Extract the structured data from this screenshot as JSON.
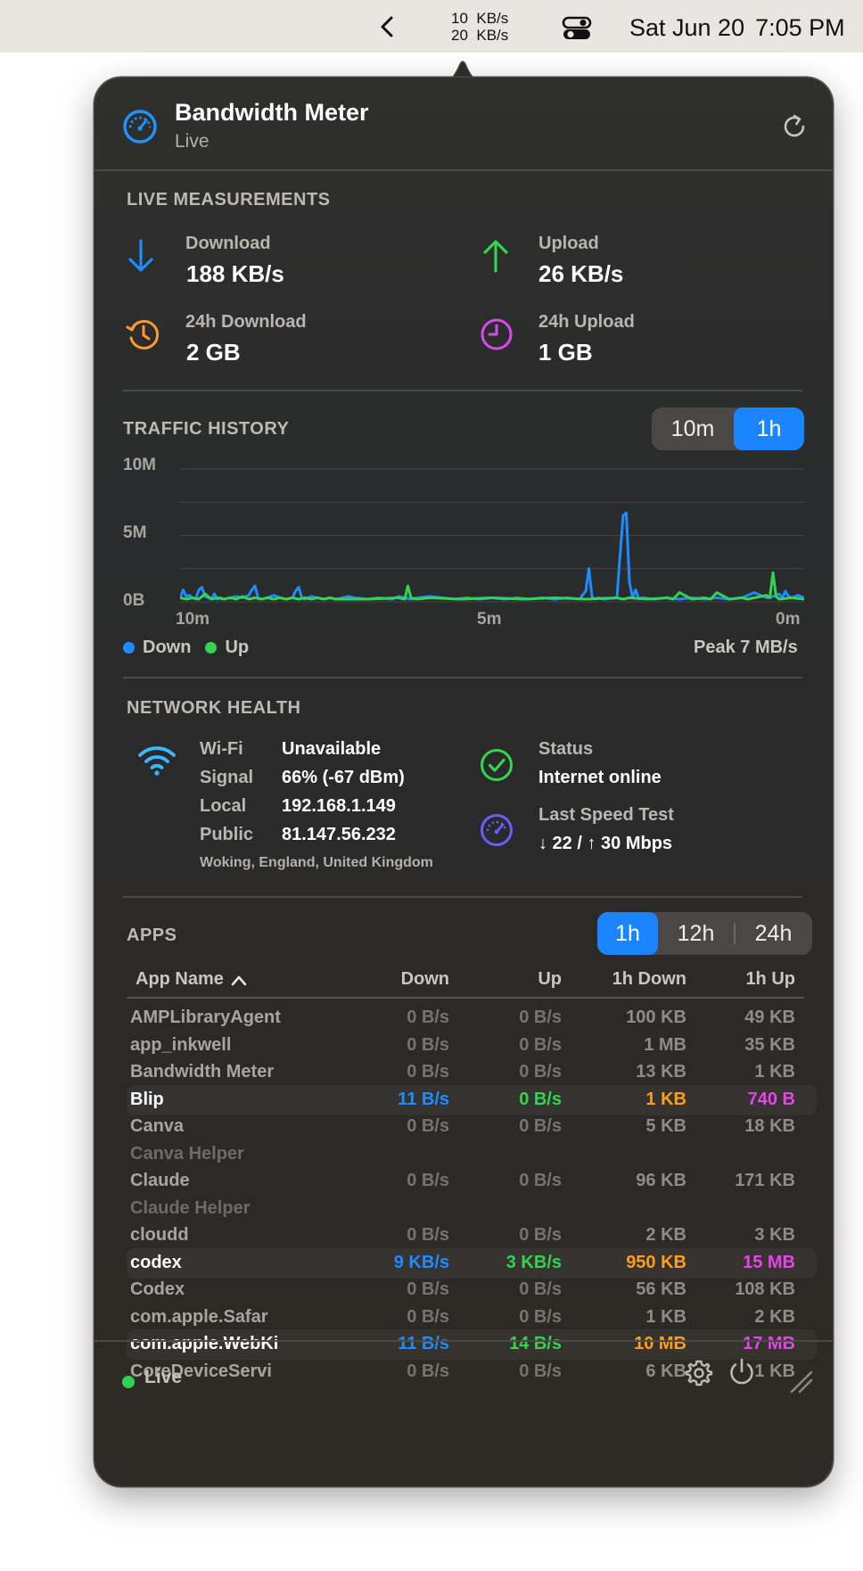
{
  "menubar": {
    "rate_down": "10  KB/s",
    "rate_up": "20  KB/s",
    "date": "Sat Jun 20",
    "time": "7:05 PM"
  },
  "header": {
    "title": "Bandwidth Meter",
    "subtitle": "Live",
    "icon": "gauge-icon",
    "refresh_icon": "refresh-icon"
  },
  "live": {
    "title": "LIVE MEASUREMENTS",
    "download_label": "Download",
    "download_value": "188 KB/s",
    "upload_label": "Upload",
    "upload_value": "26 KB/s",
    "day_download_label": "24h Download",
    "day_download_value": "2 GB",
    "day_upload_label": "24h Upload",
    "day_upload_value": "1 GB"
  },
  "traffic": {
    "title": "TRAFFIC HISTORY",
    "ranges": [
      "10m",
      "1h"
    ],
    "selected_range": "1h",
    "legend_down": "Down",
    "legend_up": "Up",
    "peak": "Peak 7 MB/s"
  },
  "chart_data": {
    "type": "line",
    "y_ticks": [
      "10M",
      "5M",
      "0B"
    ],
    "x_ticks": [
      "10m",
      "5m",
      "0m"
    ],
    "ylim": [
      0,
      10
    ],
    "xlim": [
      10,
      0
    ],
    "grid": true,
    "legend_placement": "bottom-left",
    "series": [
      {
        "name": "Down",
        "color": "#1e8cff",
        "x": [
          10.0,
          9.95,
          9.9,
          9.85,
          9.8,
          9.75,
          9.7,
          9.65,
          9.6,
          9.55,
          9.5,
          9.45,
          9.4,
          9.35,
          9.3,
          9.2,
          9.1,
          9.0,
          8.9,
          8.85,
          8.8,
          8.75,
          8.7,
          8.6,
          8.5,
          8.4,
          8.3,
          8.2,
          8.15,
          8.1,
          8.05,
          8.0,
          7.9,
          7.8,
          7.7,
          7.6,
          7.5,
          7.4,
          7.3,
          7.2,
          7.0,
          6.8,
          6.6,
          6.5,
          6.4,
          6.3,
          6.2,
          6.0,
          5.8,
          5.6,
          5.4,
          5.2,
          5.0,
          4.8,
          4.6,
          4.4,
          4.2,
          4.0,
          3.8,
          3.6,
          3.5,
          3.45,
          3.4,
          3.35,
          3.3,
          3.2,
          3.0,
          2.95,
          2.9,
          2.85,
          2.8,
          2.75,
          2.7,
          2.65,
          2.6,
          2.4,
          2.2,
          2.0,
          1.8,
          1.6,
          1.4,
          1.2,
          1.0,
          0.9,
          0.8,
          0.7,
          0.6,
          0.5,
          0.4,
          0.35,
          0.3,
          0.25,
          0.2,
          0.1,
          0.0
        ],
        "values": [
          0.3,
          0.9,
          0.4,
          0.5,
          0.3,
          0.2,
          0.9,
          1.1,
          0.4,
          0.3,
          0.2,
          0.6,
          0.2,
          0.3,
          0.2,
          0.3,
          0.4,
          0.3,
          0.5,
          0.9,
          1.2,
          0.3,
          0.2,
          0.3,
          0.5,
          0.3,
          0.2,
          0.3,
          0.8,
          1.1,
          0.3,
          0.2,
          0.4,
          0.3,
          0.2,
          0.3,
          0.2,
          0.3,
          0.4,
          0.3,
          0.2,
          0.3,
          0.2,
          0.4,
          0.3,
          0.2,
          0.3,
          0.4,
          0.3,
          0.2,
          0.3,
          0.2,
          0.3,
          0.2,
          0.3,
          0.2,
          0.3,
          0.2,
          0.3,
          0.2,
          0.8,
          2.5,
          0.4,
          0.2,
          0.3,
          0.2,
          0.3,
          3.5,
          6.5,
          6.7,
          1.5,
          0.3,
          0.9,
          0.2,
          0.3,
          0.2,
          0.3,
          0.2,
          0.3,
          0.2,
          0.3,
          0.2,
          0.3,
          0.5,
          0.7,
          0.5,
          0.3,
          0.4,
          0.6,
          0.3,
          0.8,
          0.4,
          0.3,
          0.5,
          0.3
        ]
      },
      {
        "name": "Up",
        "color": "#33d44f",
        "x": [
          10.0,
          9.9,
          9.8,
          9.7,
          9.6,
          9.5,
          9.4,
          9.3,
          9.2,
          9.1,
          9.0,
          8.9,
          8.8,
          8.7,
          8.6,
          8.5,
          8.4,
          8.3,
          8.2,
          8.1,
          8.0,
          7.9,
          7.8,
          7.7,
          7.6,
          7.5,
          7.0,
          6.5,
          6.4,
          6.35,
          6.3,
          6.2,
          6.0,
          5.5,
          5.0,
          4.5,
          4.0,
          3.5,
          3.0,
          2.9,
          2.8,
          2.5,
          2.2,
          2.1,
          2.0,
          1.8,
          1.6,
          1.5,
          1.4,
          1.2,
          1.0,
          0.9,
          0.6,
          0.55,
          0.5,
          0.45,
          0.4,
          0.2,
          0.0
        ],
        "values": [
          0.3,
          0.2,
          0.3,
          0.2,
          0.6,
          0.2,
          0.3,
          0.2,
          0.3,
          0.2,
          0.4,
          0.2,
          0.3,
          0.2,
          0.3,
          0.2,
          0.3,
          0.2,
          0.3,
          0.2,
          0.3,
          0.2,
          0.3,
          0.2,
          0.3,
          0.2,
          0.2,
          0.3,
          0.2,
          1.2,
          0.3,
          0.2,
          0.3,
          0.2,
          0.3,
          0.2,
          0.3,
          0.2,
          0.3,
          0.2,
          0.3,
          0.2,
          0.3,
          0.2,
          0.7,
          0.2,
          0.3,
          0.2,
          0.7,
          0.2,
          0.3,
          0.2,
          0.5,
          0.3,
          2.2,
          0.4,
          0.2,
          0.3,
          0.2
        ]
      }
    ]
  },
  "health": {
    "title": "NETWORK HEALTH",
    "wifi_label": "Wi-Fi",
    "wifi_value": "Unavailable",
    "signal_label": "Signal",
    "signal_value": "66% (-67 dBm)",
    "local_label": "Local",
    "local_value": "192.168.1.149",
    "public_label": "Public",
    "public_value": "81.147.56.232",
    "location": "Woking, England, United Kingdom",
    "status_label": "Status",
    "status_value": "Internet online",
    "speedtest_label": "Last Speed Test",
    "speedtest_value": "↓ 22 / ↑ 30 Mbps"
  },
  "apps": {
    "title": "APPS",
    "ranges": [
      "1h",
      "12h",
      "24h"
    ],
    "selected_range": "1h",
    "columns": {
      "name": "App Name",
      "down": "Down",
      "up": "Up",
      "period_down": "1h Down",
      "period_up": "1h Up"
    },
    "rows": [
      {
        "name": "AMPLibraryAgent",
        "down": "0 B/s",
        "up": "0 B/s",
        "period_down": "100 KB",
        "period_up": "49 KB",
        "active": false
      },
      {
        "name": "app_inkwell",
        "down": "0 B/s",
        "up": "0 B/s",
        "period_down": "1 MB",
        "period_up": "35 KB",
        "active": false
      },
      {
        "name": "Bandwidth Meter",
        "down": "0 B/s",
        "up": "0 B/s",
        "period_down": "13 KB",
        "period_up": "1 KB",
        "active": false
      },
      {
        "name": "Blip",
        "down": "11 B/s",
        "up": "0 B/s",
        "period_down": "1 KB",
        "period_up": "740 B",
        "active": true
      },
      {
        "name": "Canva",
        "helper": "Canva Helper",
        "down": "0 B/s",
        "up": "0 B/s",
        "period_down": "5 KB",
        "period_up": "18 KB",
        "active": false
      },
      {
        "name": "Claude",
        "helper": "Claude Helper",
        "down": "0 B/s",
        "up": "0 B/s",
        "period_down": "96 KB",
        "period_up": "171 KB",
        "active": false
      },
      {
        "name": "cloudd",
        "down": "0 B/s",
        "up": "0 B/s",
        "period_down": "2 KB",
        "period_up": "3 KB",
        "active": false
      },
      {
        "name": "codex",
        "down": "9 KB/s",
        "up": "3 KB/s",
        "period_down": "950 KB",
        "period_up": "15 MB",
        "active": true
      },
      {
        "name": "Codex",
        "down": "0 B/s",
        "up": "0 B/s",
        "period_down": "56 KB",
        "period_up": "108 KB",
        "active": false
      },
      {
        "name": "com.apple.Safar",
        "down": "0 B/s",
        "up": "0 B/s",
        "period_down": "1 KB",
        "period_up": "2 KB",
        "active": false
      },
      {
        "name": "com.apple.WebKi",
        "down": "11 B/s",
        "up": "14 B/s",
        "period_down": "10 MB",
        "period_up": "17 MB",
        "active": true
      },
      {
        "name": "CoreDeviceServi",
        "down": "0 B/s",
        "up": "0 B/s",
        "period_down": "6 KB",
        "period_up": "1 KB",
        "active": false
      }
    ]
  },
  "footer": {
    "status": "Live"
  },
  "colors": {
    "accent": "#1b84ff",
    "download": "#1e8cff",
    "upload": "#33d44f",
    "period_down": "#ff9d1e",
    "period_up": "#e545e8",
    "history": "#ff9a2e",
    "clock": "#d64bf0",
    "speedtest": "#6a5cff",
    "wifi": "#3bb9ff"
  }
}
